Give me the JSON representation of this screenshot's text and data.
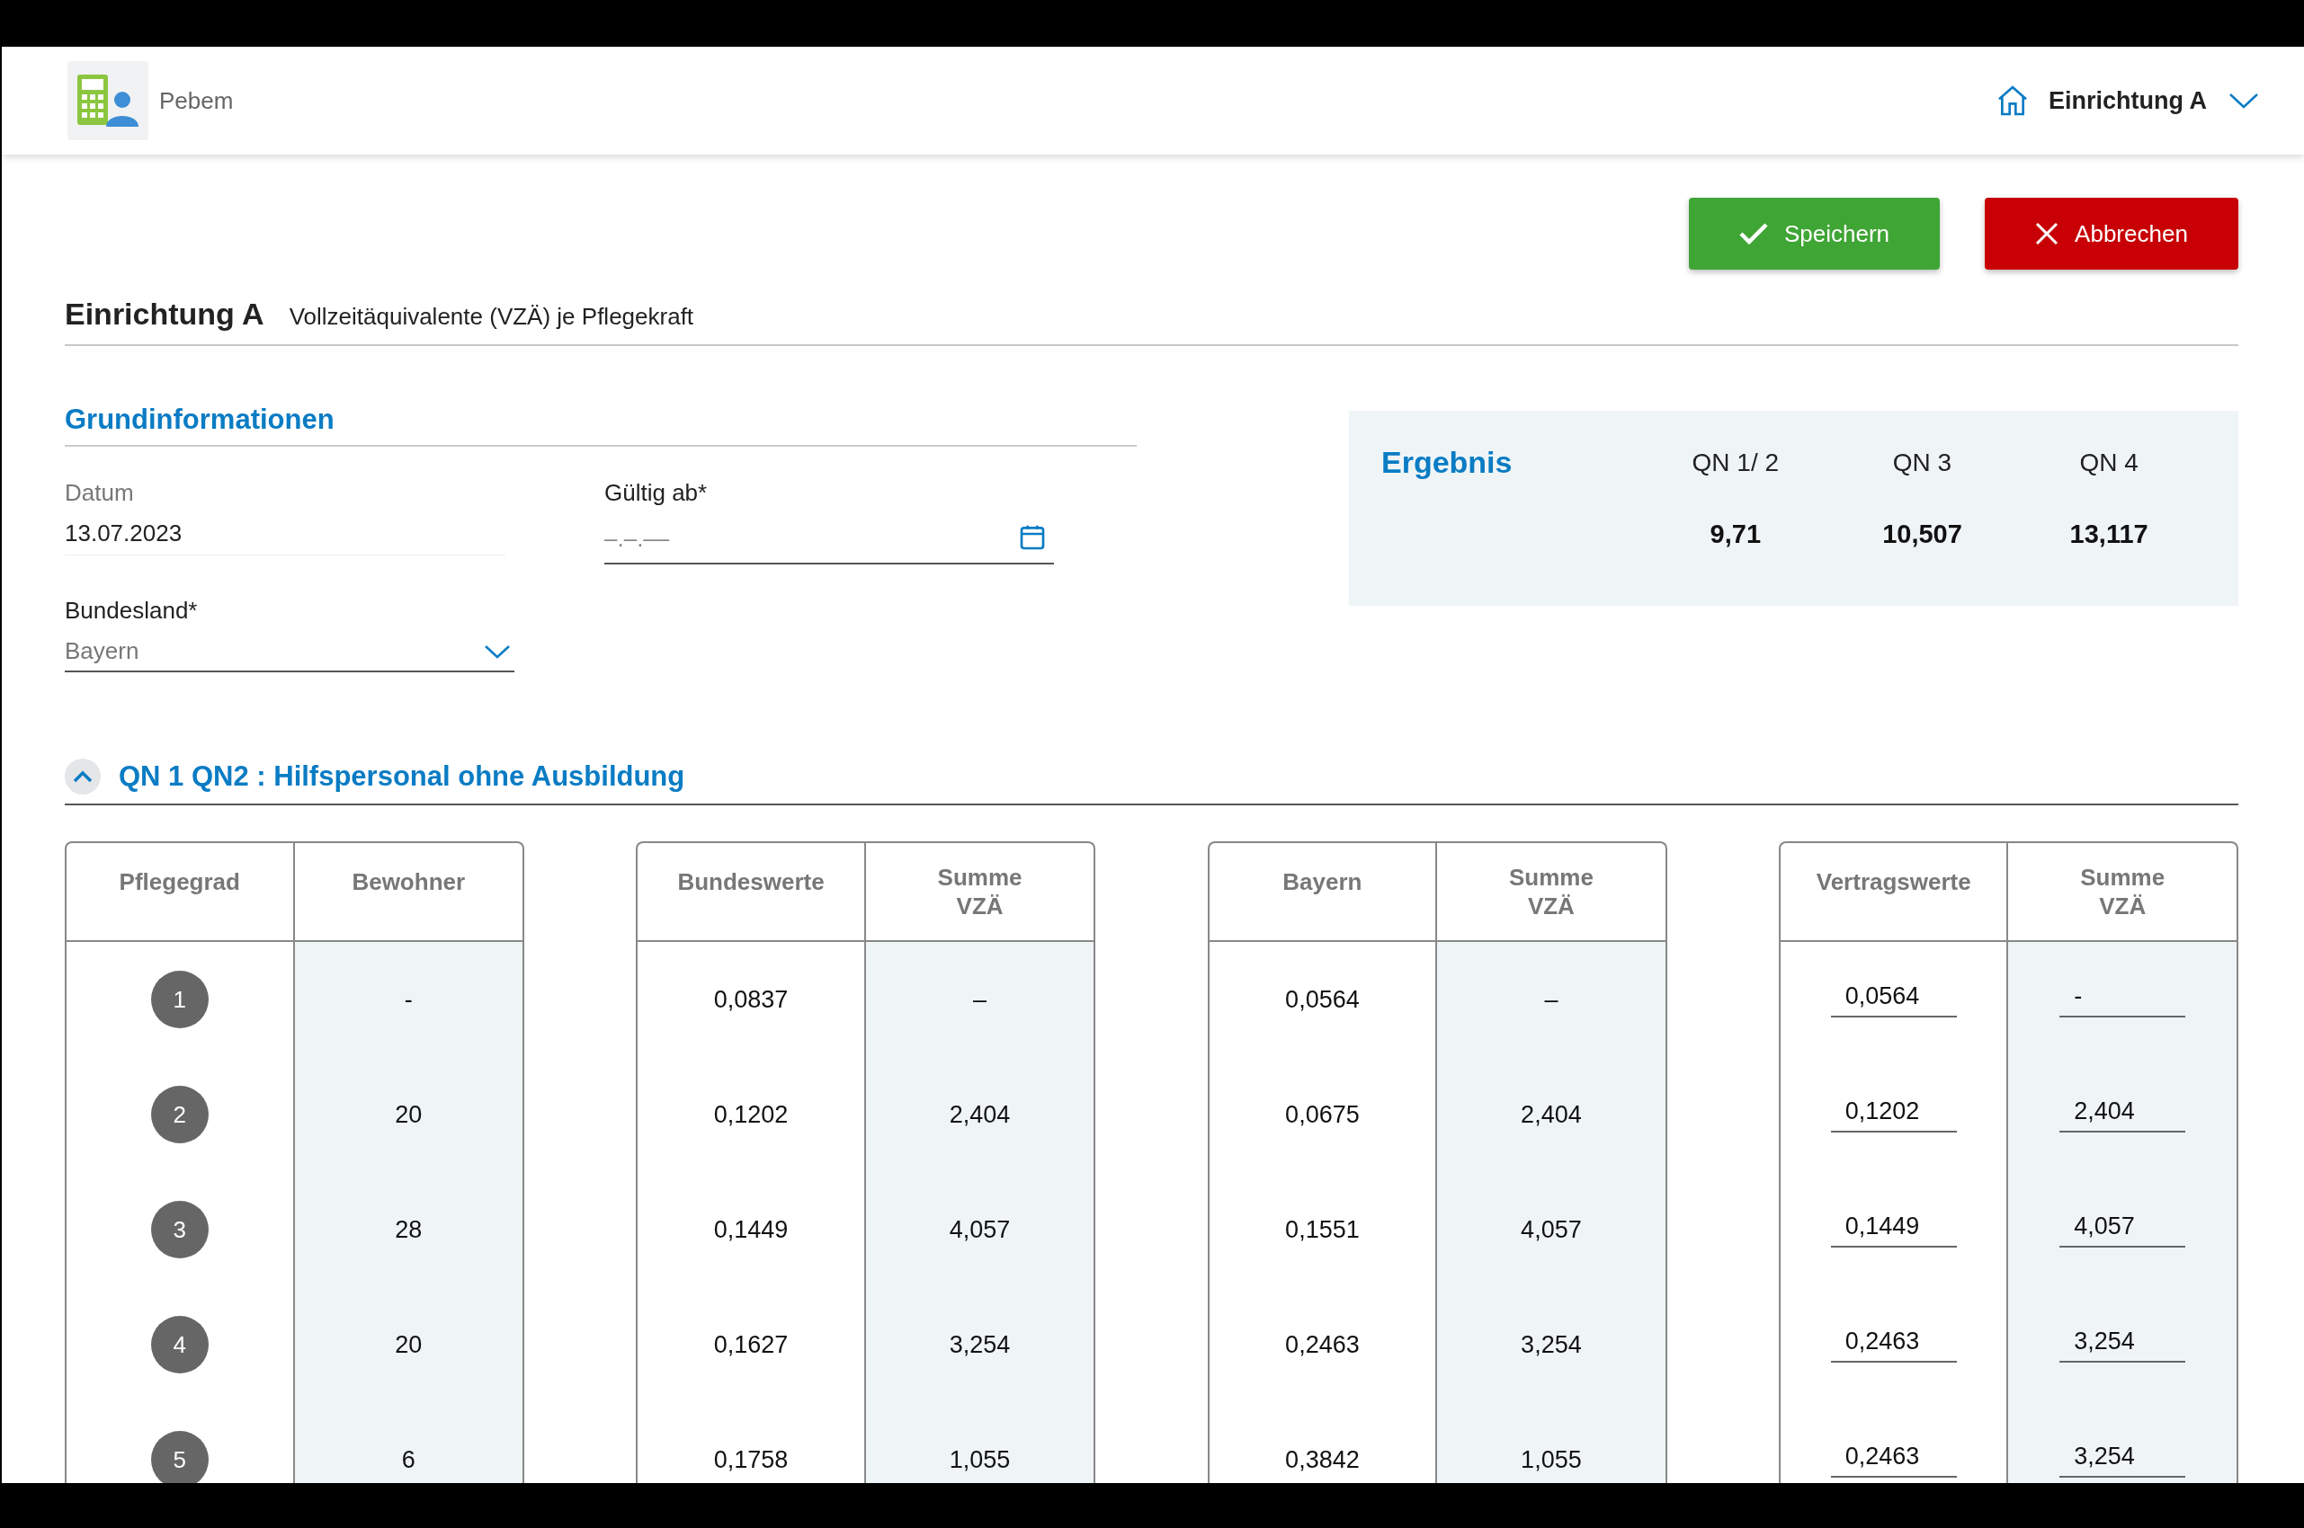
{
  "app": {
    "name": "Pebem",
    "facility": "Einrichtung A"
  },
  "actions": [
    {
      "kind": "save",
      "label": "Speichern"
    },
    {
      "kind": "cancel",
      "label": "Abbrechen"
    }
  ],
  "page_title": {
    "title": "Einrichtung A",
    "subtitle": "Vollzeitäquivalente (VZÄ) je Pflegekraft"
  },
  "basic_info": {
    "heading": "Grundinformationen",
    "date_label": "Datum",
    "date_value": "13.07.2023",
    "valid_label": "Gültig ab*",
    "valid_placeholder": "–.–.––",
    "state_label": "Bundesland*",
    "state_value": "Bayern"
  },
  "result": {
    "title": "Ergebnis",
    "columns": [
      {
        "label": "QN 1/ 2",
        "value": "9,71"
      },
      {
        "label": "QN 3",
        "value": "10,507"
      },
      {
        "label": "QN 4",
        "value": "13,117"
      }
    ]
  },
  "section": {
    "title": "QN 1 QN2 : Hilfspersonal ohne Ausbildung",
    "expanded": true
  },
  "tables": [
    {
      "kind": "grades",
      "columns": [
        "Pflegegrad",
        "Bewohner"
      ],
      "rows": [
        [
          "1",
          "-"
        ],
        [
          "2",
          "20"
        ],
        [
          "3",
          "28"
        ],
        [
          "4",
          "20"
        ],
        [
          "5",
          "6"
        ]
      ]
    },
    {
      "kind": "plain",
      "columns": [
        "Bundeswerte",
        "Summe\nVZÄ"
      ],
      "rows": [
        [
          "0,0837",
          "–"
        ],
        [
          "0,1202",
          "2,404"
        ],
        [
          "0,1449",
          "4,057"
        ],
        [
          "0,1627",
          "3,254"
        ],
        [
          "0,1758",
          "1,055"
        ]
      ]
    },
    {
      "kind": "plain",
      "columns": [
        "Bayern",
        "Summe\nVZÄ"
      ],
      "rows": [
        [
          "0,0564",
          "–"
        ],
        [
          "0,0675",
          "2,404"
        ],
        [
          "0,1551",
          "4,057"
        ],
        [
          "0,2463",
          "3,254"
        ],
        [
          "0,3842",
          "1,055"
        ]
      ]
    },
    {
      "kind": "editable",
      "columns": [
        "Vertragswerte",
        "Summe\nVZÄ"
      ],
      "rows": [
        [
          "0,0564",
          "-"
        ],
        [
          "0,1202",
          "2,404"
        ],
        [
          "0,1449",
          "4,057"
        ],
        [
          "0,2463",
          "3,254"
        ],
        [
          "0,2463",
          "3,254"
        ]
      ]
    }
  ]
}
